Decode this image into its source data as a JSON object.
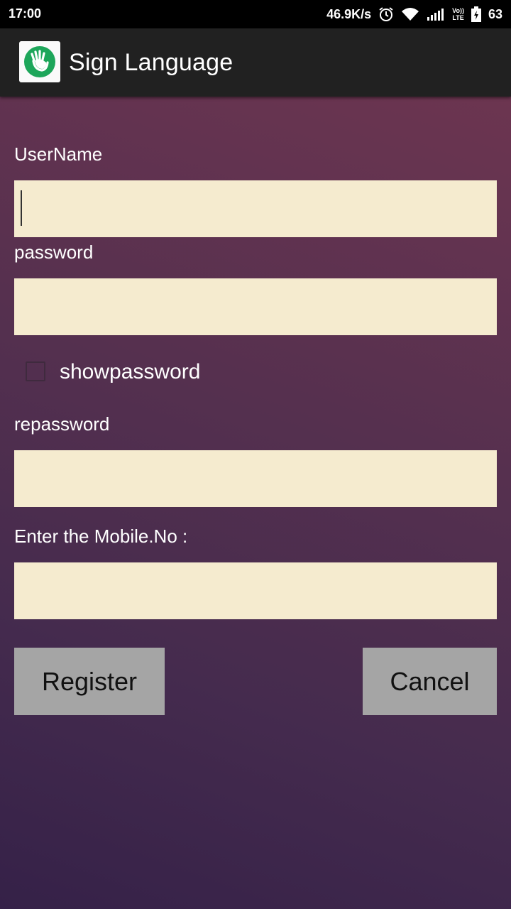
{
  "status_bar": {
    "time": "17:00",
    "network_speed": "46.9K/s",
    "volte_top": "Vo))",
    "volte_bottom": "LTE",
    "battery": "63",
    "icons": [
      "alarm-icon",
      "wifi-icon",
      "signal-icon",
      "volte-icon",
      "battery-icon"
    ]
  },
  "app_bar": {
    "title": "Sign Language",
    "logo_icon": "hand-icon",
    "logo_color": "#1da65a"
  },
  "form": {
    "username_label": "UserName",
    "username_value": "",
    "password_label": "password",
    "password_value": "",
    "show_password_label": "showpassword",
    "show_password_checked": false,
    "repassword_label": "repassword",
    "repassword_value": "",
    "mobile_label": "Enter the Mobile.No :",
    "mobile_value": ""
  },
  "buttons": {
    "register": "Register",
    "cancel": "Cancel"
  },
  "colors": {
    "field_background": "#f5ebcf",
    "button_background": "#a5a5a5",
    "app_bar_background": "#212121"
  }
}
